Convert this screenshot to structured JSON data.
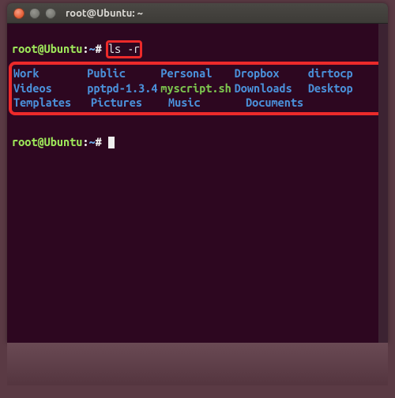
{
  "window": {
    "title": "root@Ubuntu: ~"
  },
  "prompt": {
    "user_host": "root@Ubuntu",
    "sep": ":",
    "path": "~",
    "symbol": "#"
  },
  "command": "ls -r",
  "listing": {
    "rows": [
      [
        {
          "name": "Work",
          "type": "dir"
        },
        {
          "name": "Public",
          "type": "dir"
        },
        {
          "name": "Personal",
          "type": "dir"
        },
        {
          "name": "Dropbox",
          "type": "dir"
        },
        {
          "name": "dirtocp",
          "type": "dir"
        }
      ],
      [
        {
          "name": "Videos",
          "type": "dir"
        },
        {
          "name": "pptpd-1.3.4",
          "type": "dir"
        },
        {
          "name": "myscript.sh",
          "type": "exe"
        },
        {
          "name": "Downloads",
          "type": "dir"
        },
        {
          "name": "Desktop",
          "type": "dir"
        }
      ],
      [
        {
          "name": "Templates",
          "type": "dir"
        },
        {
          "name": "Pictures",
          "type": "dir"
        },
        {
          "name": "Music",
          "type": "dir"
        },
        {
          "name": "Documents",
          "type": "dir"
        }
      ]
    ]
  },
  "highlight_colors": {
    "box": "#ec2a2a"
  }
}
